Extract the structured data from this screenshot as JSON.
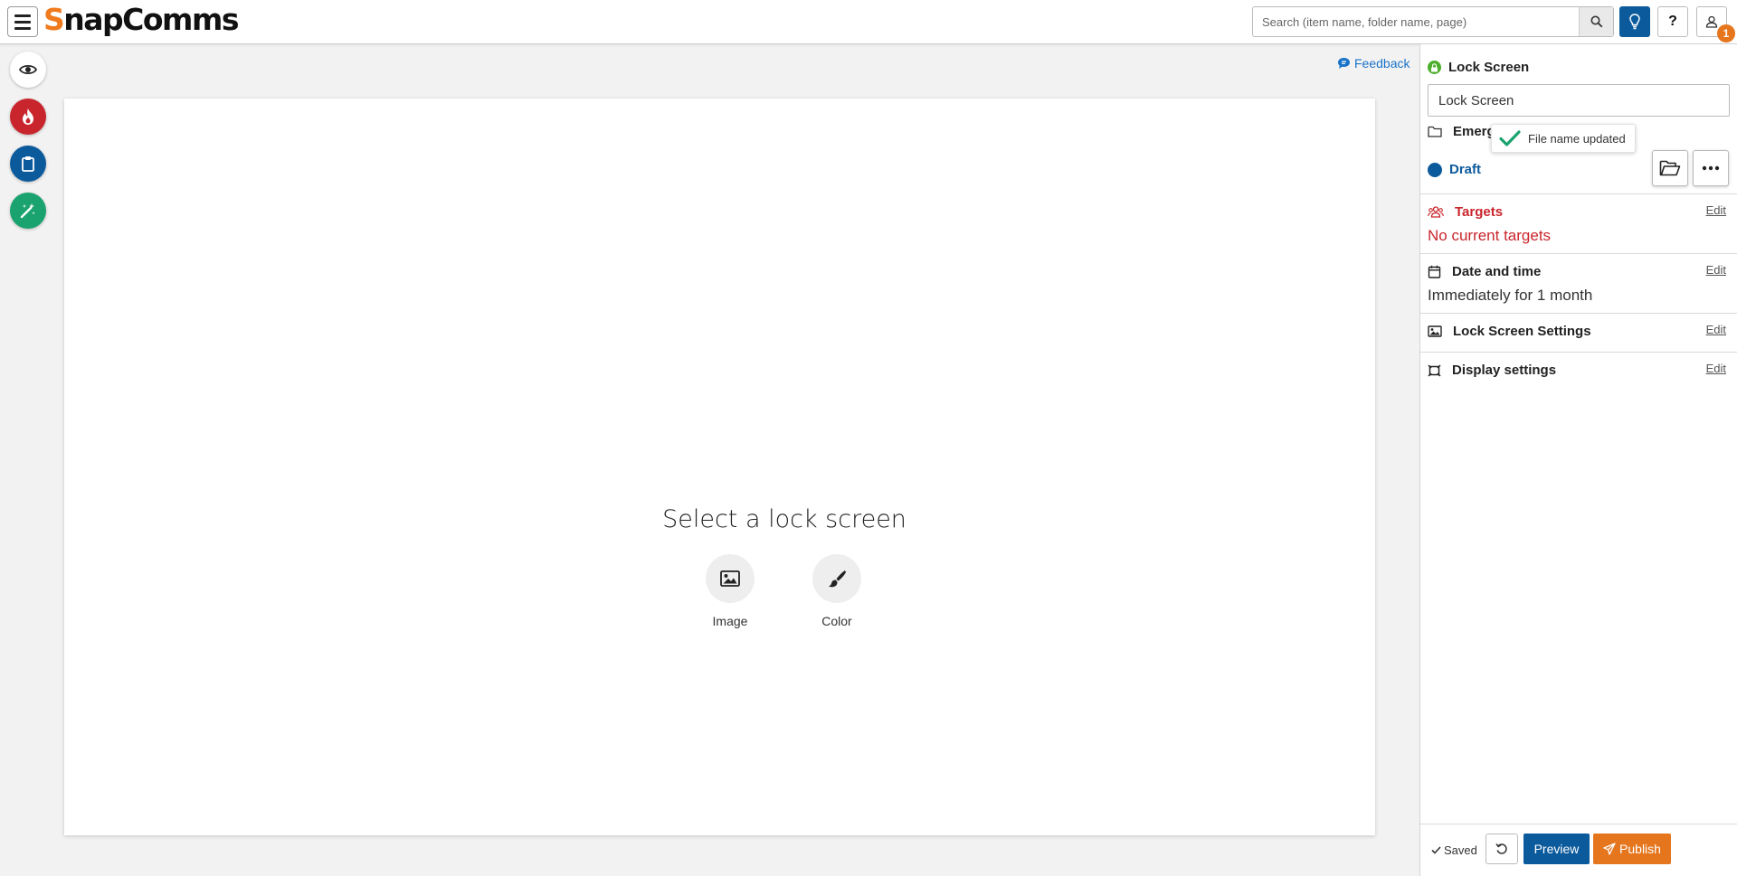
{
  "app": {
    "logo_first_letter": "S",
    "logo_rest": "napComms",
    "brand_color": "#f07b1f",
    "accent_color": "#0b5a9c"
  },
  "header": {
    "search_placeholder": "Search (item name, folder name, page)",
    "help_label": "?",
    "notification_count": "1",
    "icons": [
      "menu-icon",
      "search-icon",
      "lightbulb-icon",
      "help-icon",
      "user-icon"
    ]
  },
  "left_toolbar": {
    "icons": [
      "eye-icon",
      "fire-icon",
      "clipboard-icon",
      "magic-wand-icon"
    ],
    "colors": [
      "#ffffff",
      "#c9252c",
      "#0b5a9c",
      "#1aa36f"
    ]
  },
  "feedback_label": "Feedback",
  "canvas": {
    "title": "Select a lock screen",
    "options": [
      {
        "label": "Image",
        "icon": "image-icon"
      },
      {
        "label": "Color",
        "icon": "paintbrush-icon"
      }
    ]
  },
  "panel": {
    "item_type": "Lock Screen",
    "item_name_value": "Lock Screen",
    "folder_partial": "Emerg",
    "toast": "File name updated",
    "status": "Draft",
    "sections": {
      "targets": {
        "title": "Targets",
        "value": "No current targets",
        "edit": "Edit"
      },
      "date": {
        "title": "Date and time",
        "value": "Immediately for 1 month",
        "edit": "Edit"
      },
      "lock_settings": {
        "title": "Lock Screen Settings",
        "edit": "Edit"
      },
      "display": {
        "title": "Display settings",
        "edit": "Edit"
      }
    },
    "footer": {
      "saved": "Saved",
      "preview": "Preview",
      "publish": "Publish"
    }
  }
}
